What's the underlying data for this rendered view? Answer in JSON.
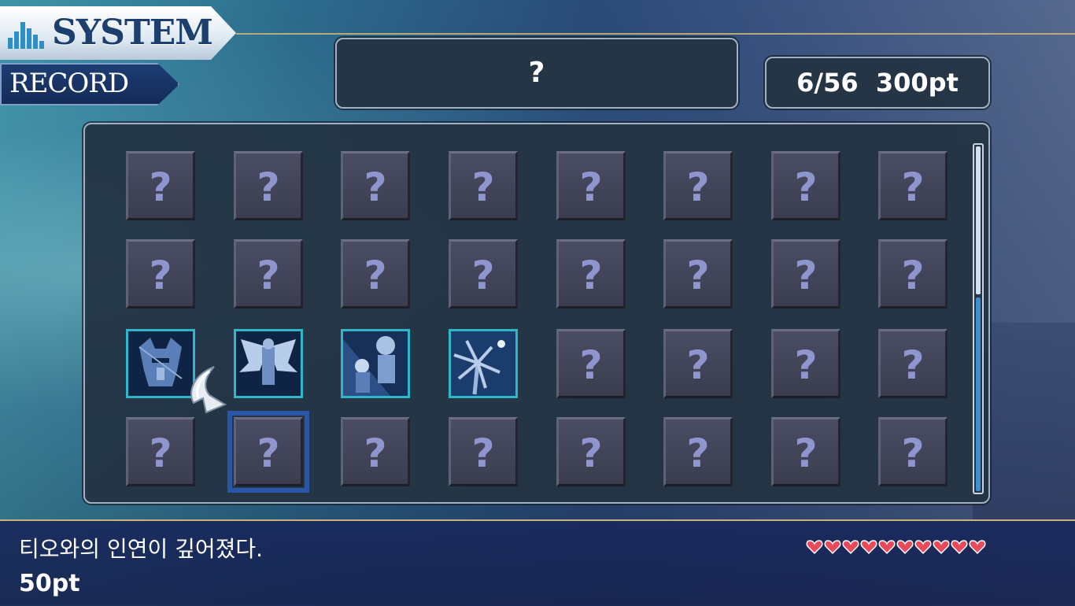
{
  "header": {
    "system_label": "SYSTEM",
    "record_label": "RECORD"
  },
  "record": {
    "title": "?",
    "stats": "6/56  300pt"
  },
  "grid": {
    "placeholder_glyph": "?",
    "rows": [
      [
        "locked",
        "locked",
        "locked",
        "locked",
        "locked",
        "locked",
        "locked",
        "locked"
      ],
      [
        "locked",
        "locked",
        "locked",
        "locked",
        "locked",
        "locked",
        "locked",
        "locked"
      ],
      [
        "unlocked-knight",
        "unlocked-wings",
        "unlocked-duo",
        "unlocked-palm",
        "locked",
        "locked",
        "locked",
        "locked"
      ],
      [
        "locked",
        "locked",
        "locked",
        "locked",
        "locked",
        "locked",
        "locked",
        "locked"
      ]
    ],
    "selected": {
      "row": 3,
      "col": 1
    }
  },
  "scrollbar": {
    "position": 0.0,
    "visible_fraction": 0.43
  },
  "info": {
    "description": "티오와의 인연이 깊어졌다.",
    "points": "50pt",
    "hearts": 10
  },
  "colors": {
    "accent_gold": "#c7b27a",
    "tile_question": "#8f96cf",
    "unlocked_border": "#2fb7c9",
    "selection": "#2a56a8",
    "heart": "#e84a5a"
  }
}
